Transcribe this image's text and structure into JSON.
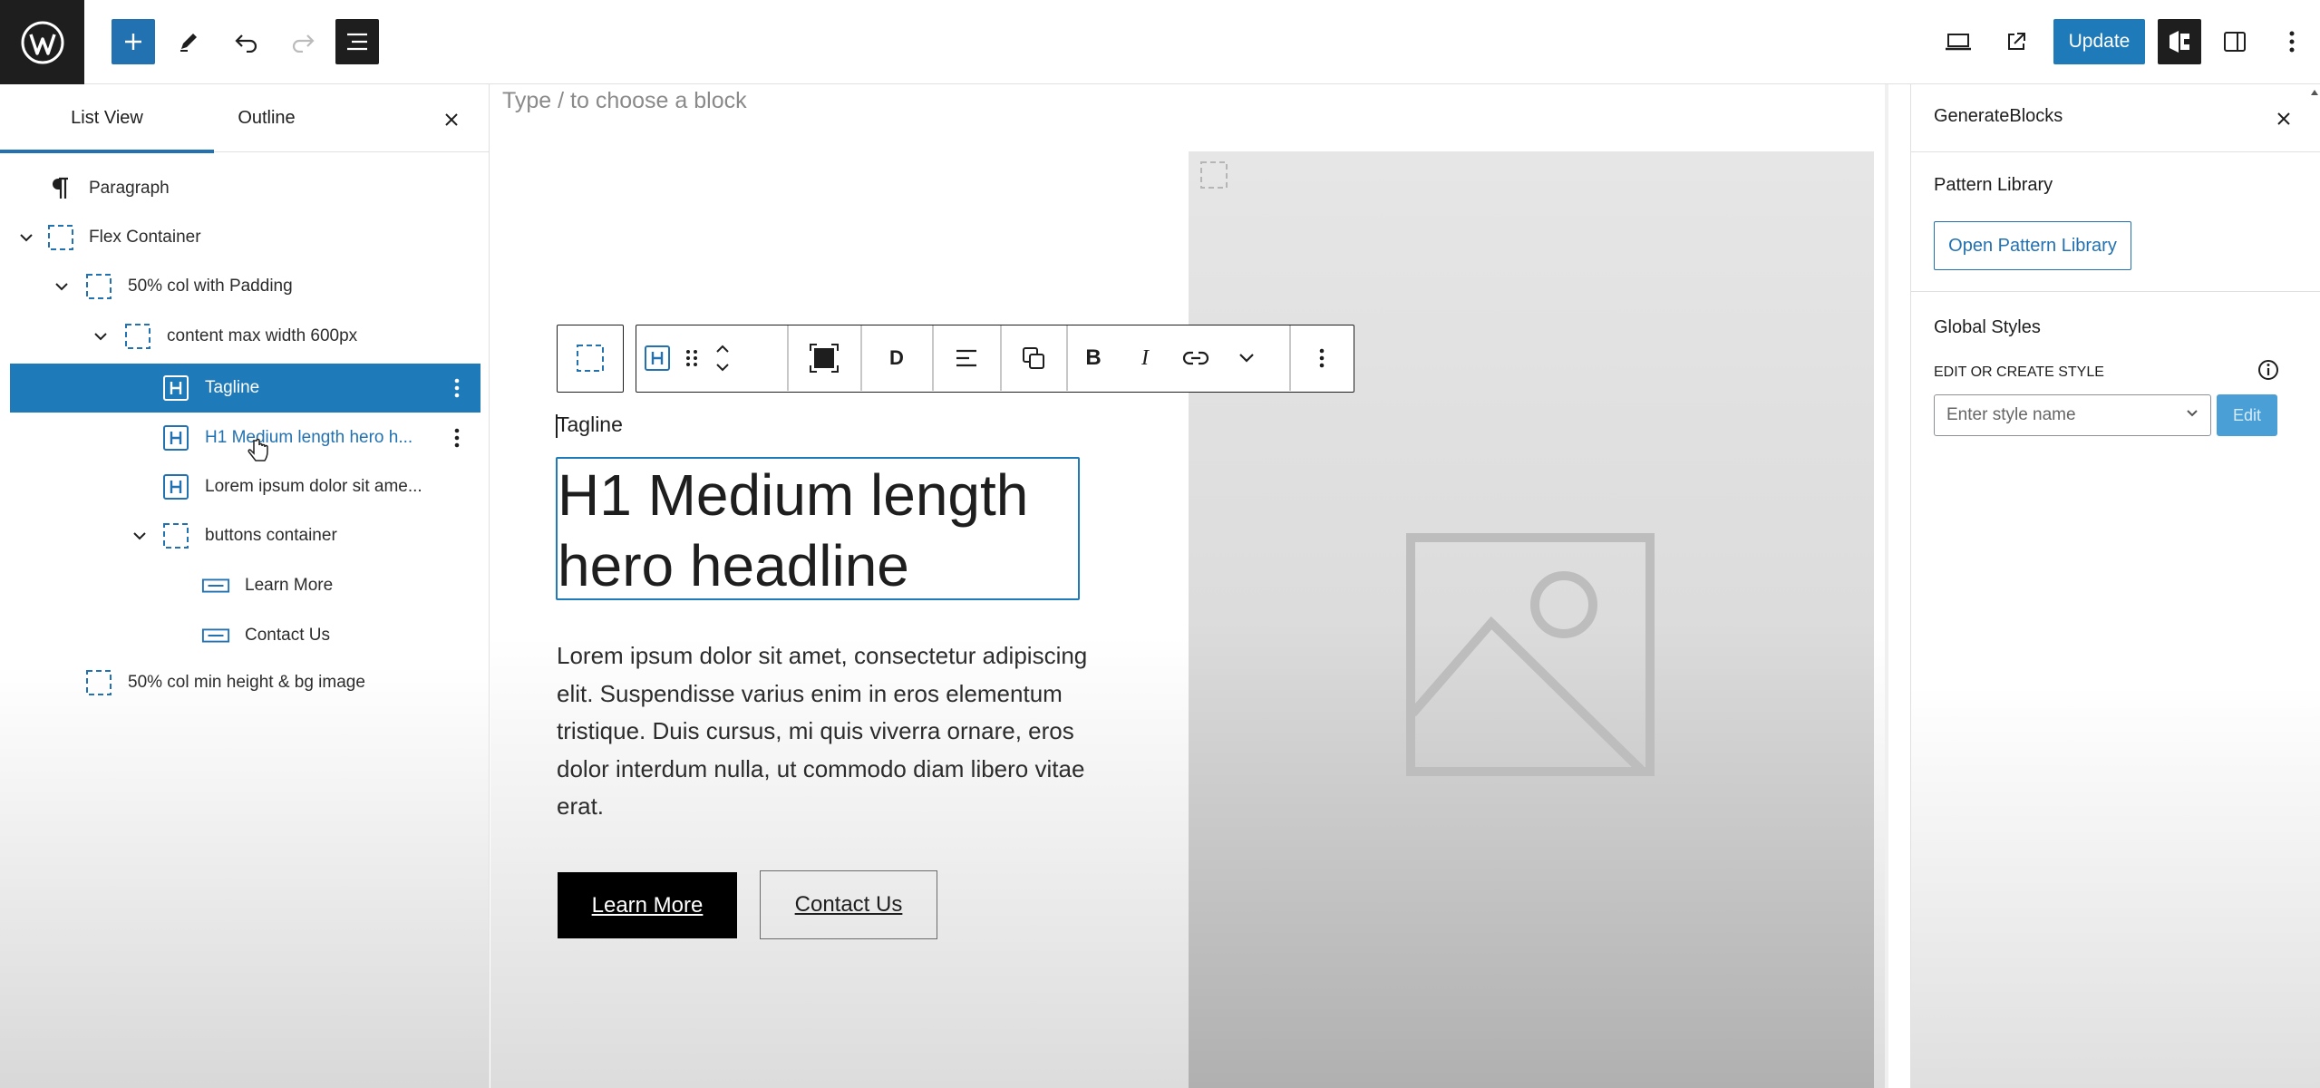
{
  "topbar": {
    "update_label": "Update"
  },
  "left_panel": {
    "tabs": [
      {
        "label": "List View"
      },
      {
        "label": "Outline"
      }
    ],
    "tree": [
      {
        "label": "Paragraph"
      },
      {
        "label": "Flex Container"
      },
      {
        "label": "50% col with Padding"
      },
      {
        "label": "content max width 600px"
      },
      {
        "label": "Tagline"
      },
      {
        "label": "H1 Medium length hero h..."
      },
      {
        "label": "Lorem ipsum dolor sit ame..."
      },
      {
        "label": "buttons container"
      },
      {
        "label": "Learn More"
      },
      {
        "label": "Contact Us"
      },
      {
        "label": "50% col min height & bg image"
      }
    ]
  },
  "canvas": {
    "appender_placeholder": "Type / to choose a block",
    "tagline": "Tagline",
    "headline": "H1 Medium length hero headline",
    "body_text": "Lorem ipsum dolor sit amet, consectetur adipiscing elit. Suspendisse varius enim in eros elementum tristique. Duis cursus, mi quis viverra ornare, eros dolor interdum nulla, ut commodo diam libero vitae erat.",
    "buttons": [
      {
        "label": "Learn More"
      },
      {
        "label": "Contact Us"
      }
    ],
    "toolbar": {
      "dynamic_label": "D",
      "bold_label": "B",
      "italic_label": "I"
    }
  },
  "right_panel": {
    "title": "GenerateBlocks",
    "pattern_library": {
      "heading": "Pattern Library",
      "button": "Open Pattern Library"
    },
    "global_styles": {
      "heading": "Global Styles",
      "label": "EDIT OR CREATE STYLE",
      "select_placeholder": "Enter style name",
      "edit_button": "Edit"
    }
  },
  "colors": {
    "accent": "#1e7ab8",
    "dark": "#1e1e1e",
    "selected_row": "#1e7ab8",
    "headline_outline": "#1e7ab8"
  },
  "icons": [
    "wordpress-icon",
    "plus-icon",
    "pencil-icon",
    "undo-icon",
    "redo-icon",
    "list-view-icon",
    "desktop-preview-icon",
    "external-link-icon",
    "generateblocks-icon",
    "sidebar-toggle-icon",
    "kebab-icon",
    "close-icon",
    "paragraph-icon",
    "container-icon",
    "heading-icon",
    "button-icon",
    "chevron-down-icon",
    "image-placeholder-icon",
    "info-icon"
  ]
}
